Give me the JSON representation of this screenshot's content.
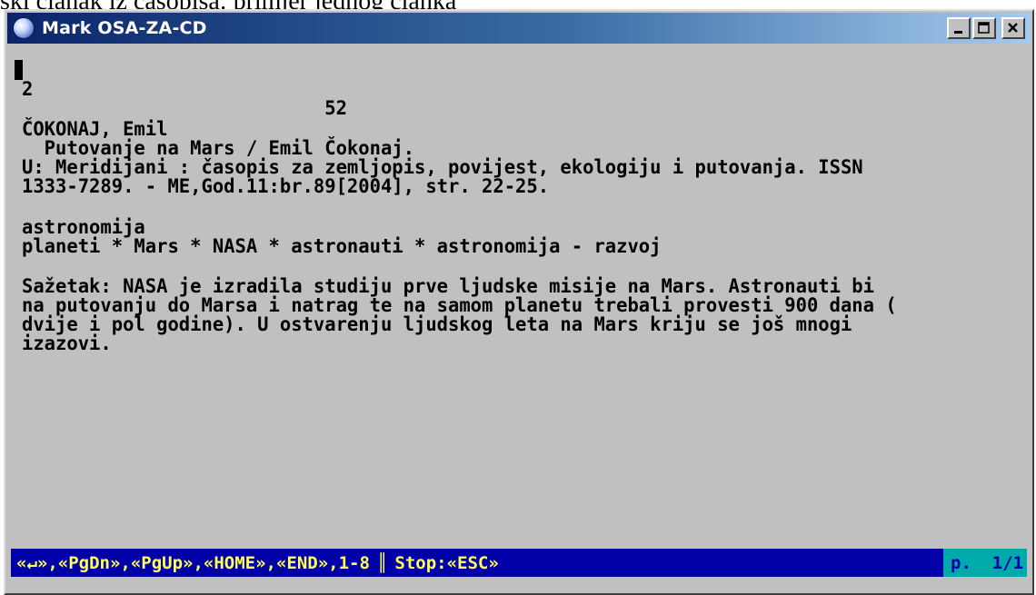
{
  "caption": "ski članak iz časopisa: primjer jednog članka",
  "window": {
    "title": "Mark OSA-ZA-CD",
    "controls": {
      "minimize": "minimize-icon",
      "maximize": "maximize-icon",
      "close": "close-icon"
    }
  },
  "record": {
    "lines": [
      "2",
      "                           52",
      "ČOKONAJ, Emil",
      "  Putovanje na Mars / Emil Čokonaj.",
      "U: Meridijani : časopis za zemljopis, povijest, ekologiju i putovanja. ISSN",
      "1333-7289. - ME,God.11:br.89[2004], str. 22-25.",
      "",
      "astronomija",
      "planeti * Mars * NASA * astronauti * astronomija - razvoj",
      "",
      "Sažetak: NASA je izradila studiju prve ljudske misije na Mars. Astronauti bi",
      "na putovanju do Marsa i natrag te na samom planetu trebali provesti 900 dana (",
      "dvije i pol godine). U ostvarenju ljudskog leta na Mars kriju se još mnogi",
      "izazovi."
    ]
  },
  "status": {
    "keys": "«↵»,«PgDn»,«PgUp»,«HOME»,«END»,1-8",
    "separator": "║",
    "stop": "Stop:«ESC»",
    "page": "p.  1/1"
  },
  "colors": {
    "window_bg": "#c0c0c0",
    "title_start": "#0a246a",
    "status_bg": "#0000a8",
    "status_fg": "#ffff55",
    "page_bg": "#00aaaa"
  }
}
